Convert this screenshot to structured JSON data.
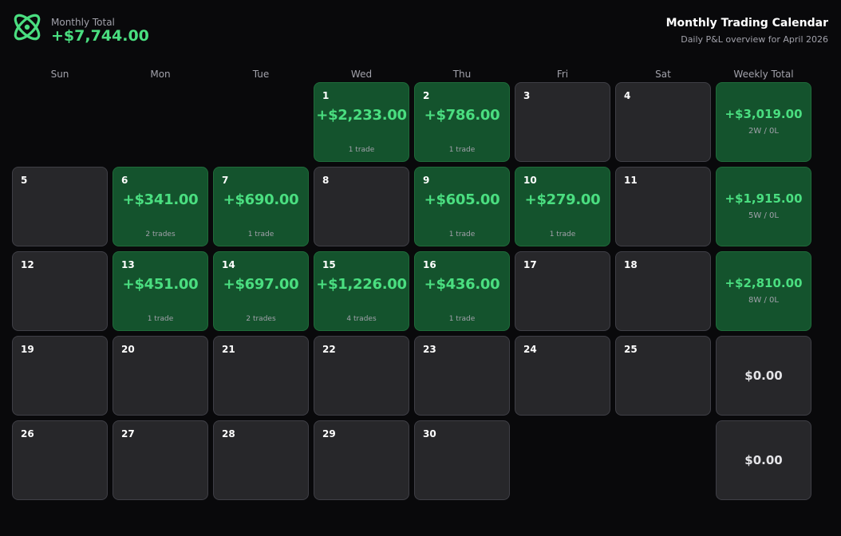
{
  "header": {
    "monthly_label": "Monthly Total",
    "monthly_value": "+$7,744.00",
    "title": "Monthly Trading Calendar",
    "subtitle": "Daily P&L overview for April 2026",
    "logo_icon": "atom-logo-icon",
    "accent_color": "#4ade80"
  },
  "weekdays": [
    "Sun",
    "Mon",
    "Tue",
    "Wed",
    "Thu",
    "Fri",
    "Sat",
    "Weekly Total"
  ],
  "weeks": [
    {
      "days": [
        null,
        null,
        null,
        {
          "day": "1",
          "pnl": "+$2,233.00",
          "trades": "1 trade"
        },
        {
          "day": "2",
          "pnl": "+$786.00",
          "trades": "1 trade"
        },
        {
          "day": "3"
        },
        {
          "day": "4"
        }
      ],
      "total": "+$3,019.00",
      "record": "2W / 0L"
    },
    {
      "days": [
        {
          "day": "5"
        },
        {
          "day": "6",
          "pnl": "+$341.00",
          "trades": "2 trades"
        },
        {
          "day": "7",
          "pnl": "+$690.00",
          "trades": "1 trade"
        },
        {
          "day": "8"
        },
        {
          "day": "9",
          "pnl": "+$605.00",
          "trades": "1 trade"
        },
        {
          "day": "10",
          "pnl": "+$279.00",
          "trades": "1 trade"
        },
        {
          "day": "11"
        }
      ],
      "total": "+$1,915.00",
      "record": "5W / 0L"
    },
    {
      "days": [
        {
          "day": "12"
        },
        {
          "day": "13",
          "pnl": "+$451.00",
          "trades": "1 trade"
        },
        {
          "day": "14",
          "pnl": "+$697.00",
          "trades": "2 trades"
        },
        {
          "day": "15",
          "pnl": "+$1,226.00",
          "trades": "4 trades"
        },
        {
          "day": "16",
          "pnl": "+$436.00",
          "trades": "1 trade"
        },
        {
          "day": "17"
        },
        {
          "day": "18"
        }
      ],
      "total": "+$2,810.00",
      "record": "8W / 0L"
    },
    {
      "days": [
        {
          "day": "19"
        },
        {
          "day": "20"
        },
        {
          "day": "21"
        },
        {
          "day": "22"
        },
        {
          "day": "23"
        },
        {
          "day": "24"
        },
        {
          "day": "25"
        }
      ],
      "total": "$0.00",
      "record": ""
    },
    {
      "days": [
        {
          "day": "26"
        },
        {
          "day": "27"
        },
        {
          "day": "28"
        },
        {
          "day": "29"
        },
        {
          "day": "30"
        },
        null,
        null
      ],
      "total": "$0.00",
      "record": ""
    }
  ]
}
